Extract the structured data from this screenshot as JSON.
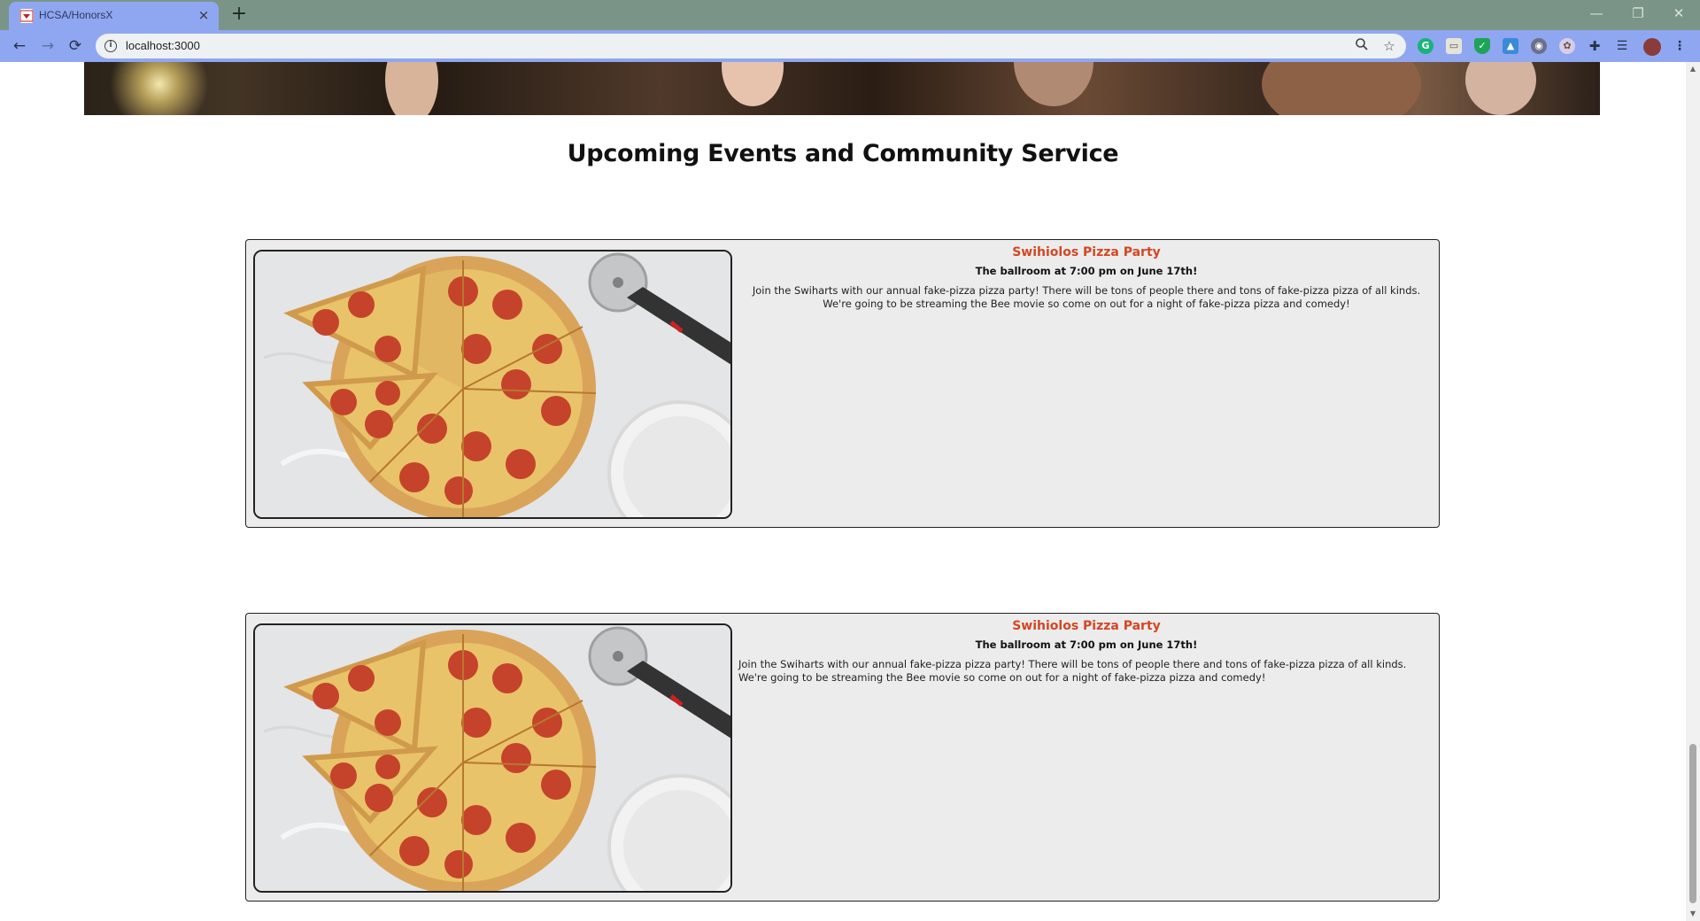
{
  "browser": {
    "tab_title": "HCSA/HonorsX",
    "tab_close": "×",
    "new_tab": "+",
    "url": "localhost:3000",
    "window_controls": {
      "minimize": "—",
      "restore": "❐",
      "close": "✕"
    },
    "nav": {
      "back": "←",
      "forward": "→",
      "reload": "⟳"
    }
  },
  "page": {
    "section_title": "Upcoming Events and Community Service",
    "events": [
      {
        "title": "Swihiolos Pizza Party",
        "subtitle": "The ballroom at 7:00 pm on June 17th!",
        "description": "Join the Swiharts with our annual fake-pizza pizza party! There will be tons of people there and tons of fake-pizza pizza of all kinds. We're going to be streaming the Bee movie so come on out for a night of fake-pizza pizza and comedy!"
      },
      {
        "title": "Swihiolos Pizza Party",
        "subtitle": "The ballroom at 7:00 pm on June 17th!",
        "description": "Join the Swiharts with our annual fake-pizza pizza party! There will be tons of people there and tons of fake-pizza pizza of all kinds. We're going to be streaming the Bee movie so come on out for a night of fake-pizza pizza and comedy!"
      }
    ]
  },
  "colors": {
    "tab_bar": "#7a9587",
    "toolbar": "#8fa7f0",
    "card_bg": "#ececec",
    "event_title": "#d34723"
  }
}
